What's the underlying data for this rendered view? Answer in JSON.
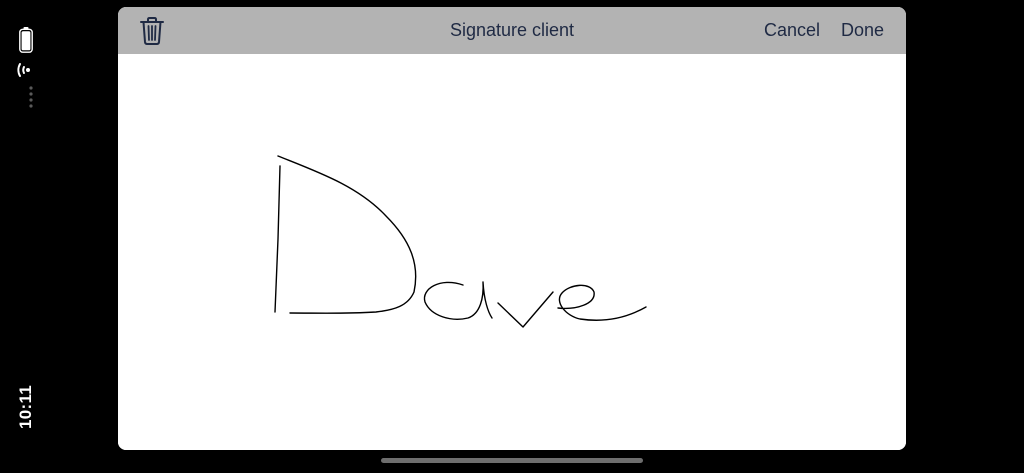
{
  "status_bar": {
    "time": "10:11",
    "icons": [
      "battery-icon",
      "wifi-icon",
      "cellular-dots-icon"
    ]
  },
  "sheet": {
    "title": "Signature client",
    "delete_icon": "trash-icon",
    "cancel_label": "Cancel",
    "done_label": "Done"
  },
  "colors": {
    "nav_background": "#b3b3b3",
    "nav_text": "#1f2a44",
    "canvas_background": "#ffffff",
    "ink": "#000000",
    "screen_background": "#000000"
  }
}
